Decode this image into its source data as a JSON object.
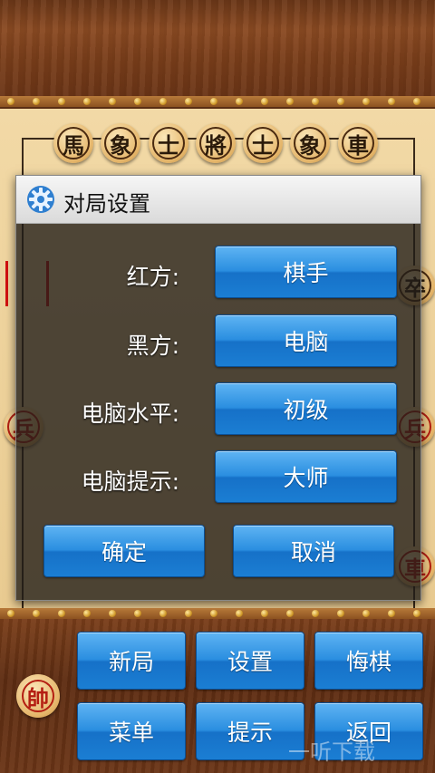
{
  "board": {
    "top_pieces": [
      "馬",
      "象",
      "士",
      "將",
      "士",
      "象",
      "車"
    ],
    "side_pieces_left": [
      "兵"
    ],
    "side_pieces_right": [
      "卒",
      "兵",
      "車"
    ],
    "general_piece": "帥"
  },
  "dialog": {
    "title": "对局设置",
    "rows": [
      {
        "label": "红方:",
        "value": "棋手"
      },
      {
        "label": "黑方:",
        "value": "电脑"
      },
      {
        "label": "电脑水平:",
        "value": "初级"
      },
      {
        "label": "电脑提示:",
        "value": "大师"
      }
    ],
    "confirm_label": "确定",
    "cancel_label": "取消"
  },
  "menu": {
    "buttons": [
      "新局",
      "设置",
      "悔棋",
      "菜单",
      "提示",
      "返回"
    ]
  },
  "watermark": "一听下载",
  "colors": {
    "button_blue": "#2a8ee0",
    "red_piece": "#b41e12",
    "board": "#f2d9a6"
  }
}
